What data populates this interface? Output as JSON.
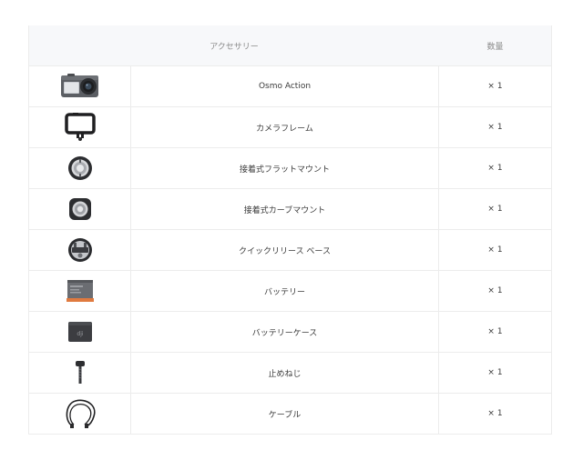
{
  "header": {
    "accessory_label": "アクセサリー",
    "quantity_label": "数量"
  },
  "items": [
    {
      "name": "Osmo Action",
      "qty": "× 1",
      "icon": "camera-icon"
    },
    {
      "name": "カメラフレーム",
      "qty": "× 1",
      "icon": "camera-frame-icon"
    },
    {
      "name": "接着式フラットマウント",
      "qty": "× 1",
      "icon": "flat-mount-icon"
    },
    {
      "name": "接着式カーブマウント",
      "qty": "× 1",
      "icon": "curved-mount-icon"
    },
    {
      "name": "クイックリリース ベース",
      "qty": "× 1",
      "icon": "quick-release-base-icon"
    },
    {
      "name": "バッテリー",
      "qty": "× 1",
      "icon": "battery-icon"
    },
    {
      "name": "バッテリーケース",
      "qty": "× 1",
      "icon": "battery-case-icon"
    },
    {
      "name": "止めねじ",
      "qty": "× 1",
      "icon": "locking-screw-icon"
    },
    {
      "name": "ケーブル",
      "qty": "× 1",
      "icon": "cable-icon"
    }
  ]
}
